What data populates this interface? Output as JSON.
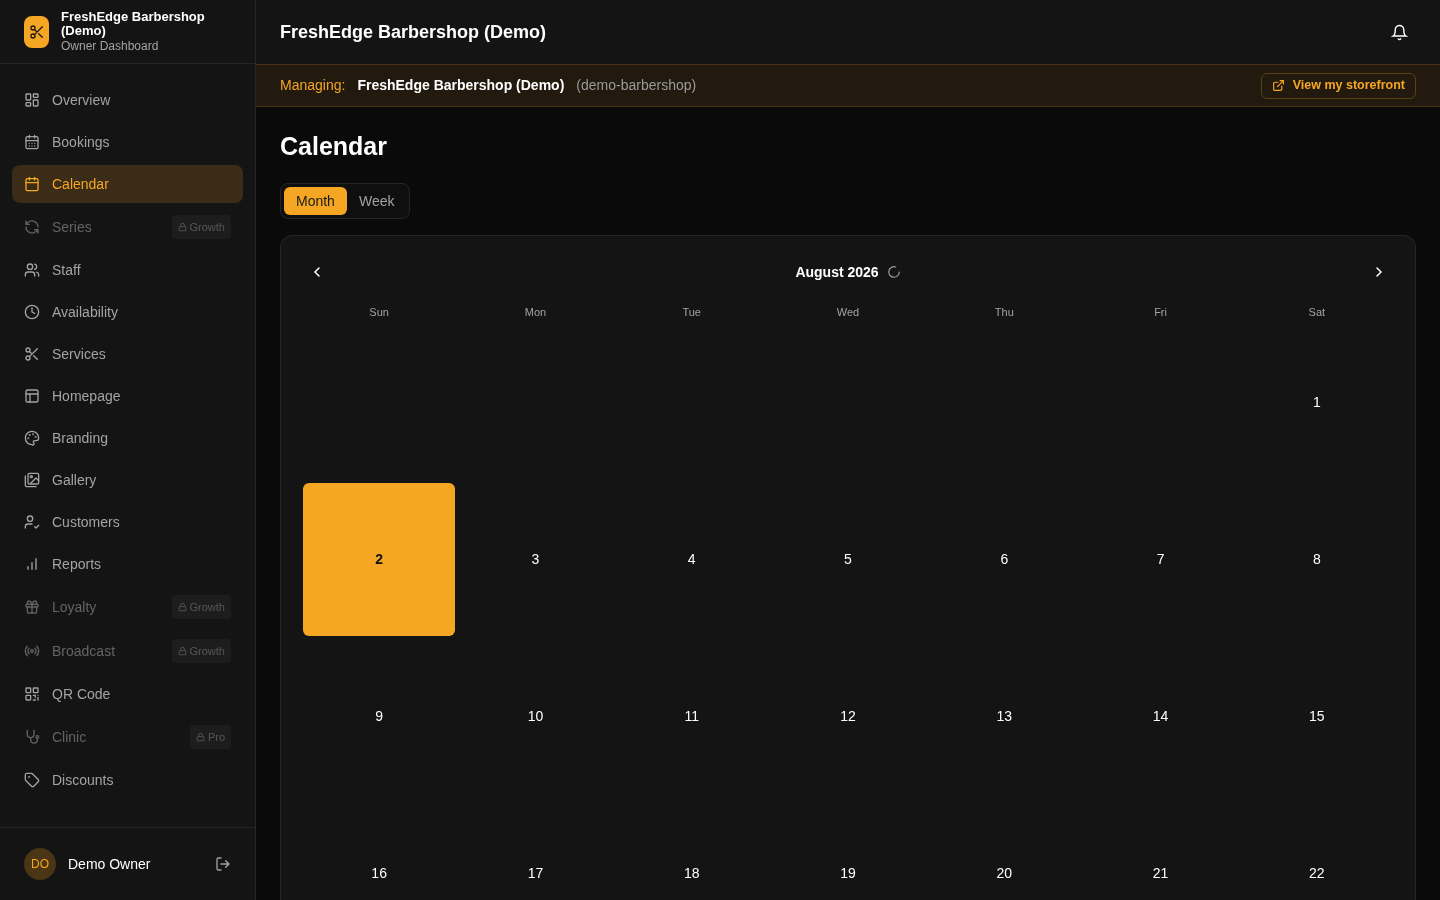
{
  "brand": {
    "name": "FreshEdge Barbershop (Demo)",
    "subtitle": "Owner Dashboard"
  },
  "sidebar": {
    "items": [
      {
        "label": "Overview",
        "selected": false,
        "disabled": false
      },
      {
        "label": "Bookings",
        "selected": false,
        "disabled": false
      },
      {
        "label": "Calendar",
        "selected": true,
        "disabled": false
      },
      {
        "label": "Series",
        "selected": false,
        "disabled": true,
        "badge": "Growth"
      },
      {
        "label": "Staff",
        "selected": false,
        "disabled": false
      },
      {
        "label": "Availability",
        "selected": false,
        "disabled": false
      },
      {
        "label": "Services",
        "selected": false,
        "disabled": false
      },
      {
        "label": "Homepage",
        "selected": false,
        "disabled": false
      },
      {
        "label": "Branding",
        "selected": false,
        "disabled": false
      },
      {
        "label": "Gallery",
        "selected": false,
        "disabled": false
      },
      {
        "label": "Customers",
        "selected": false,
        "disabled": false
      },
      {
        "label": "Reports",
        "selected": false,
        "disabled": false
      },
      {
        "label": "Loyalty",
        "selected": false,
        "disabled": true,
        "badge": "Growth"
      },
      {
        "label": "Broadcast",
        "selected": false,
        "disabled": true,
        "badge": "Growth"
      },
      {
        "label": "QR Code",
        "selected": false,
        "disabled": false
      },
      {
        "label": "Clinic",
        "selected": false,
        "disabled": true,
        "badge": "Pro"
      },
      {
        "label": "Discounts",
        "selected": false,
        "disabled": false
      }
    ]
  },
  "user": {
    "initials": "DO",
    "name": "Demo Owner"
  },
  "header": {
    "title": "FreshEdge Barbershop (Demo)"
  },
  "managing": {
    "label": "Managing:",
    "name": "FreshEdge Barbershop (Demo)",
    "slug": "(demo-barbershop)",
    "button": "View my storefront"
  },
  "page_title": "Calendar",
  "view_tabs": [
    {
      "label": "Month",
      "selected": true
    },
    {
      "label": "Week",
      "selected": false
    }
  ],
  "calendar": {
    "month": "August 2026",
    "loading": true,
    "weekdays": [
      "Sun",
      "Mon",
      "Tue",
      "Wed",
      "Thu",
      "Fri",
      "Sat"
    ],
    "weeks": [
      [
        {
          "kind": "blank"
        },
        {
          "kind": "blank"
        },
        {
          "kind": "blank"
        },
        {
          "kind": "blank"
        },
        {
          "kind": "blank"
        },
        {
          "kind": "blank"
        },
        {
          "kind": "day",
          "day": "1",
          "selected": false
        }
      ],
      [
        {
          "kind": "day",
          "day": "2",
          "selected": true
        },
        {
          "kind": "day",
          "day": "3",
          "selected": false
        },
        {
          "kind": "day",
          "day": "4",
          "selected": false
        },
        {
          "kind": "day",
          "day": "5",
          "selected": false
        },
        {
          "kind": "day",
          "day": "6",
          "selected": false
        },
        {
          "kind": "day",
          "day": "7",
          "selected": false
        },
        {
          "kind": "day",
          "day": "8",
          "selected": false
        }
      ],
      [
        {
          "kind": "day",
          "day": "9",
          "selected": false
        },
        {
          "kind": "day",
          "day": "10",
          "selected": false
        },
        {
          "kind": "day",
          "day": "11",
          "selected": false
        },
        {
          "kind": "day",
          "day": "12",
          "selected": false
        },
        {
          "kind": "day",
          "day": "13",
          "selected": false
        },
        {
          "kind": "day",
          "day": "14",
          "selected": false
        },
        {
          "kind": "day",
          "day": "15",
          "selected": false
        }
      ],
      [
        {
          "kind": "day",
          "day": "16",
          "selected": false
        },
        {
          "kind": "day",
          "day": "17",
          "selected": false
        },
        {
          "kind": "day",
          "day": "18",
          "selected": false
        },
        {
          "kind": "day",
          "day": "19",
          "selected": false
        },
        {
          "kind": "day",
          "day": "20",
          "selected": false
        },
        {
          "kind": "day",
          "day": "21",
          "selected": false
        },
        {
          "kind": "day",
          "day": "22",
          "selected": false
        }
      ]
    ]
  }
}
